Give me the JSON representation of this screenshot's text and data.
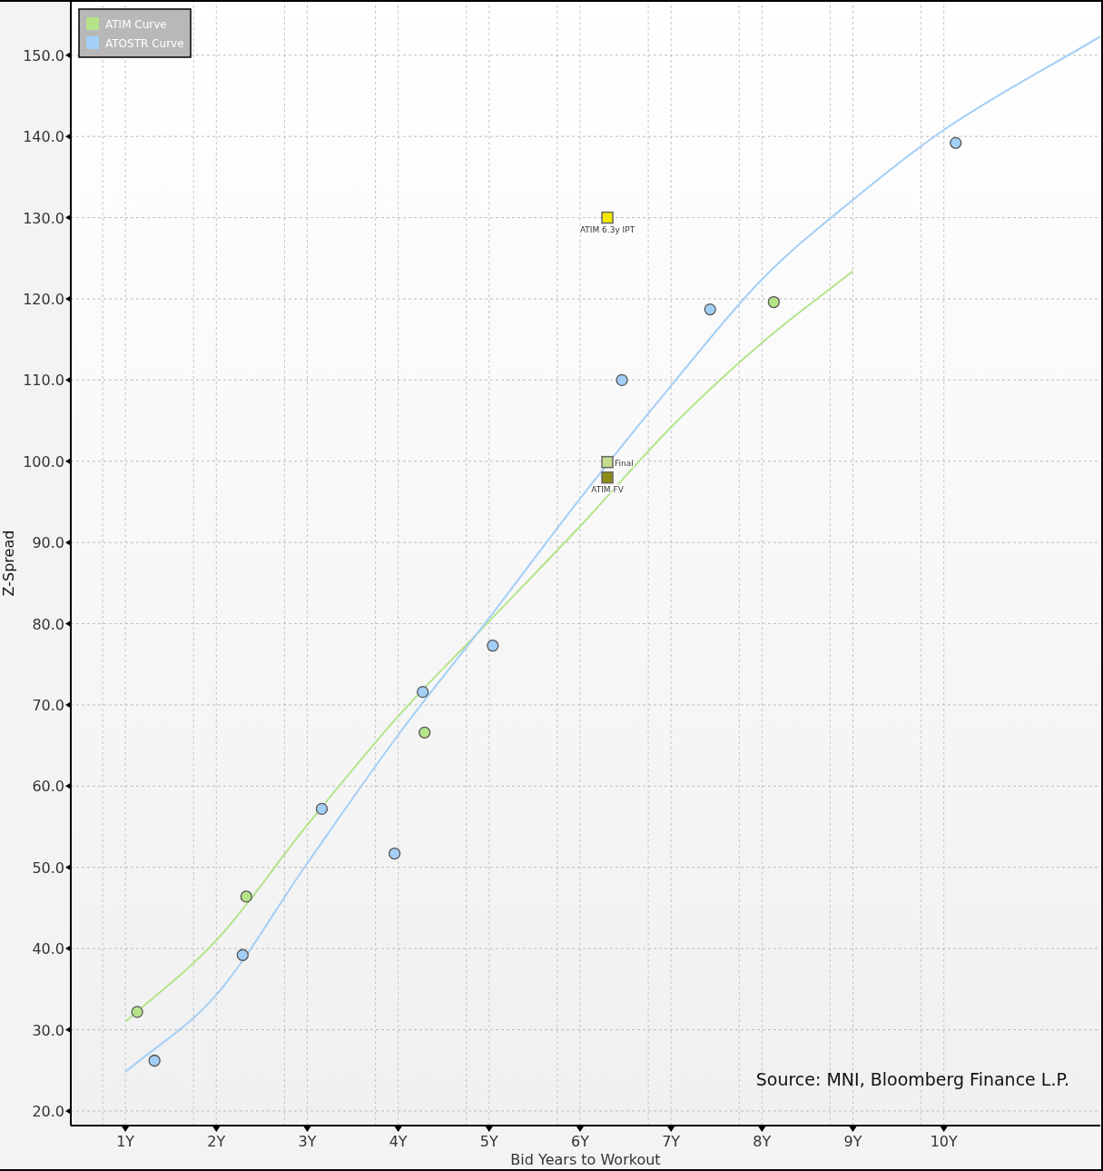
{
  "chart": {
    "source": "Source: MNI, Bloomberg Finance L.P.",
    "chart_data": {
      "type": "scatter",
      "grid": true,
      "legend": true,
      "xlabel": "Bid Years to Workout",
      "ylabel": "Z-Spread",
      "xlim": [
        0.4,
        11.72
      ],
      "ylim": [
        18.2,
        156.8
      ],
      "xticks": [
        {
          "value": 1,
          "label": "1Y"
        },
        {
          "value": 2,
          "label": "2Y"
        },
        {
          "value": 3,
          "label": "3Y"
        },
        {
          "value": 4,
          "label": "4Y"
        },
        {
          "value": 5,
          "label": "5Y"
        },
        {
          "value": 6,
          "label": "6Y"
        },
        {
          "value": 7,
          "label": "7Y"
        },
        {
          "value": 8,
          "label": "8Y"
        },
        {
          "value": 9,
          "label": "9Y"
        },
        {
          "value": 10,
          "label": "10Y"
        }
      ],
      "yticks": [
        {
          "value": 20,
          "label": "20.0"
        },
        {
          "value": 30,
          "label": "30.0"
        },
        {
          "value": 40,
          "label": "40.0"
        },
        {
          "value": 50,
          "label": "50.0"
        },
        {
          "value": 60,
          "label": "60.0"
        },
        {
          "value": 70,
          "label": "70.0"
        },
        {
          "value": 80,
          "label": "80.0"
        },
        {
          "value": 90,
          "label": "90.0"
        },
        {
          "value": 100,
          "label": "100.0"
        },
        {
          "value": 110,
          "label": "110.0"
        },
        {
          "value": 120,
          "label": "120.0"
        },
        {
          "value": 130,
          "label": "130.0"
        },
        {
          "value": 140,
          "label": "140.0"
        },
        {
          "value": 150,
          "label": "150.0"
        }
      ],
      "series": [
        {
          "name": "ATIM Curve",
          "type": "line",
          "color": "#b5e38a",
          "x": [
            1,
            2,
            3,
            4,
            5,
            6,
            7,
            8,
            9
          ],
          "values": [
            31.0,
            41.0,
            55.2,
            68.6,
            80.3,
            92.0,
            104.2,
            114.6,
            123.4
          ]
        },
        {
          "name": "ATOSTR Curve",
          "type": "line",
          "color": "#a3cff7",
          "x": [
            1,
            2,
            3,
            4,
            5,
            6,
            7,
            8,
            9,
            10,
            11.72
          ],
          "values": [
            24.8,
            34.3,
            50.5,
            66.3,
            80.7,
            95.4,
            109.3,
            122.4,
            132.2,
            140.8,
            152.3
          ]
        },
        {
          "color": "#b5e38a",
          "x": [
            1.13,
            2.33,
            4.29,
            8.13
          ],
          "values": [
            32.2,
            46.4,
            66.6,
            119.6
          ]
        },
        {
          "color": "#a3cff7",
          "x": [
            1.32,
            2.29,
            3.16,
            3.96,
            4.27,
            5.04,
            6.46,
            7.43,
            10.13
          ],
          "values": [
            26.2,
            39.2,
            57.2,
            51.7,
            71.6,
            77.3,
            110.0,
            118.7,
            139.2
          ]
        },
        {
          "name": "ATIM 6.3y IPT",
          "color": "#f5e800",
          "x": [
            6.3
          ],
          "values": [
            130.0
          ]
        },
        {
          "name": "Final",
          "color": "#c3dd8c",
          "x": [
            6.3
          ],
          "values": [
            99.9
          ]
        },
        {
          "name": "ATIM FV",
          "color": "#8c8c14",
          "x": [
            6.3
          ],
          "values": [
            98.0
          ]
        }
      ]
    }
  }
}
